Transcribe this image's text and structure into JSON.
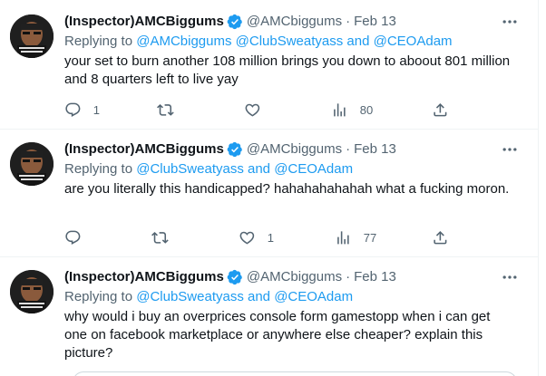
{
  "tweets": [
    {
      "display_name": "(Inspector)AMCBiggums",
      "handle": "@AMCbiggums",
      "separator": "·",
      "date": "Feb 13",
      "replying_label": "Replying to",
      "replying_mentions": "@AMCbiggums @ClubSweatyass and @CEOAdam",
      "text": "your set to burn another 108 million brings you down to aboout 801 million and 8 quarters left to live yay",
      "reply_count": "1",
      "retweet_count": "",
      "like_count": "",
      "view_count": "80"
    },
    {
      "display_name": "(Inspector)AMCBiggums",
      "handle": "@AMCbiggums",
      "separator": "·",
      "date": "Feb 13",
      "replying_label": "Replying to",
      "replying_mentions": "@ClubSweatyass and @CEOAdam",
      "text": "are you literally this handicapped? hahahahahahah what a fucking moron.",
      "reply_count": "",
      "retweet_count": "",
      "like_count": "1",
      "view_count": "77"
    },
    {
      "display_name": "(Inspector)AMCBiggums",
      "handle": "@AMCbiggums",
      "separator": "·",
      "date": "Feb 13",
      "replying_label": "Replying to",
      "replying_mentions": "@ClubSweatyass and @CEOAdam",
      "text": "why would i buy an overprices console form gamestopp when i can get one on facebook marketplace or anywhere else cheaper? explain this picture?"
    }
  ],
  "colors": {
    "text_primary": "#0f1419",
    "text_secondary": "#536471",
    "accent": "#1d9bf0",
    "border": "#eff3f4"
  },
  "icons": [
    "verified-badge-icon",
    "more-icon",
    "reply-icon",
    "retweet-icon",
    "like-icon",
    "views-icon",
    "share-icon"
  ]
}
